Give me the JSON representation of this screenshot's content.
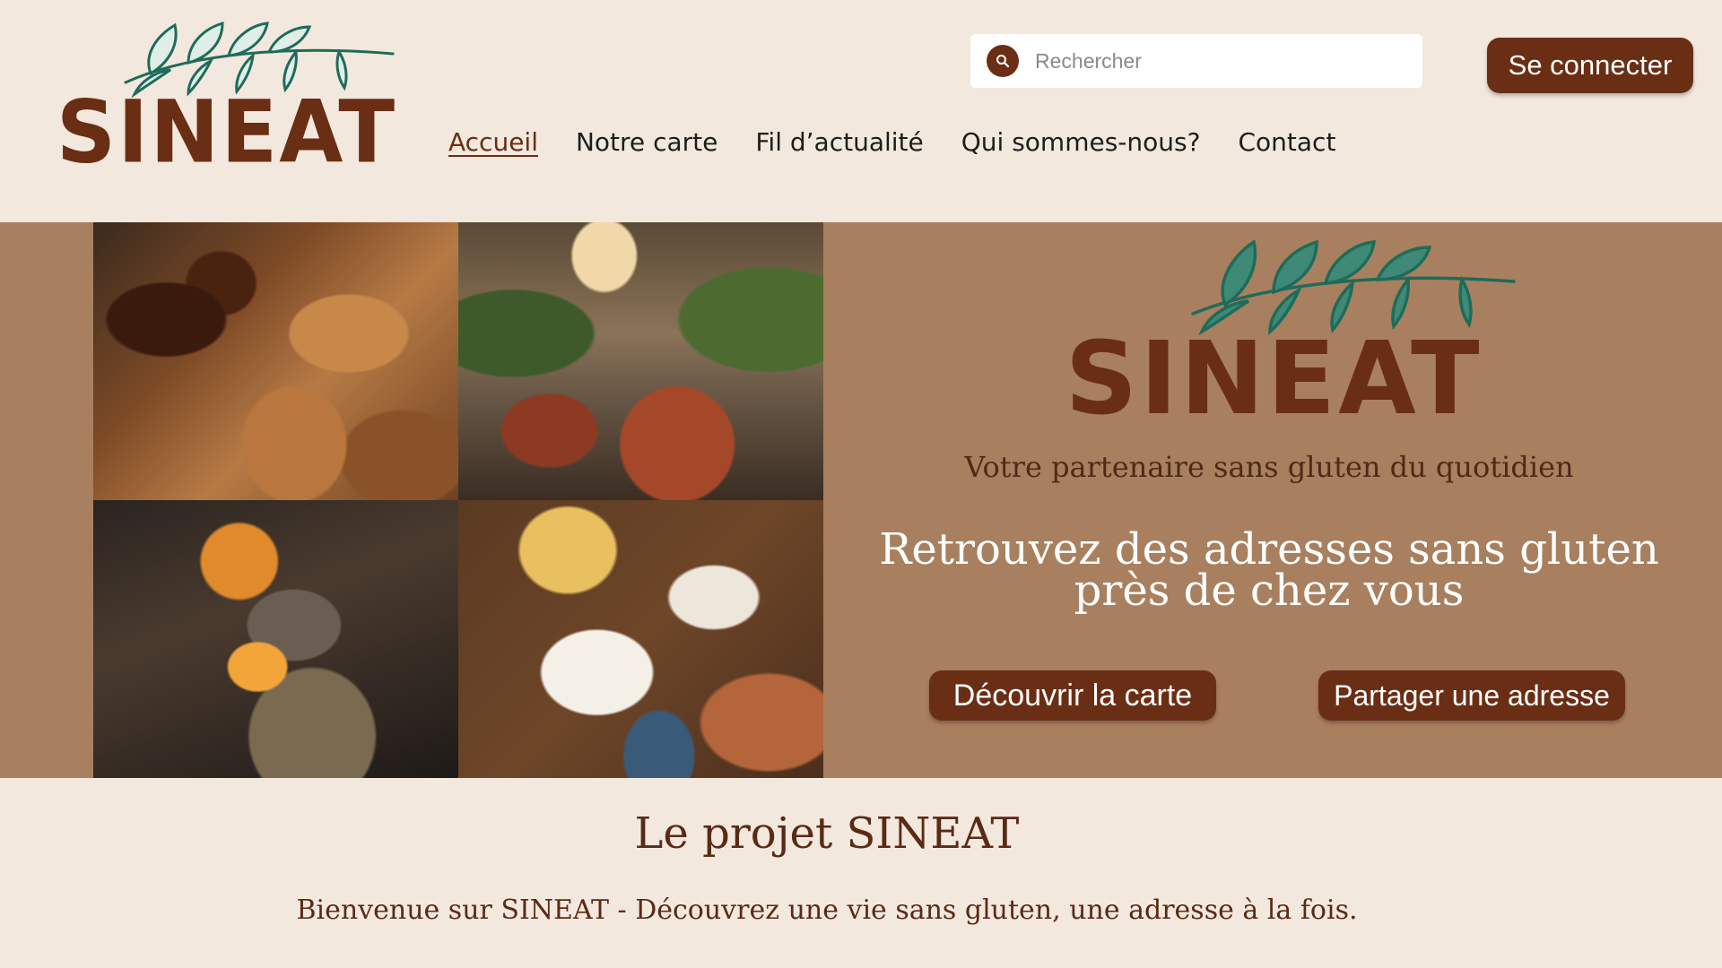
{
  "header": {
    "logo_text": "SINEAT",
    "search": {
      "placeholder": "Rechercher"
    },
    "login_label": "Se connecter",
    "nav": [
      {
        "label": "Accueil",
        "active": true
      },
      {
        "label": "Notre carte"
      },
      {
        "label": "Fil d’actualité"
      },
      {
        "label": "Qui sommes-nous?"
      },
      {
        "label": "Contact"
      }
    ]
  },
  "hero": {
    "logo_text": "SINEAT",
    "tagline": "Votre partenaire sans gluten du quotidien",
    "title_line1": "Retrouvez des adresses sans gluten",
    "title_line2": "près de chez vous",
    "button_carte": "Découvrir la carte",
    "button_partager": "Partager une adresse",
    "photos": [
      "grilled-meat-tacos-photo",
      "restaurant-interior-photo",
      "kitchen-flames-photo",
      "shared-dishes-photo"
    ]
  },
  "project": {
    "title": "Le projet SINEAT",
    "text": "Bienvenue sur SINEAT - Découvrez une vie sans gluten, une adresse à la fois."
  },
  "colors": {
    "background": "#f2e8de",
    "brand_brown": "#6a2e14",
    "hero_background": "#a8805f",
    "leaf_green": "#1f6b5a",
    "text_white": "#ffffff"
  }
}
